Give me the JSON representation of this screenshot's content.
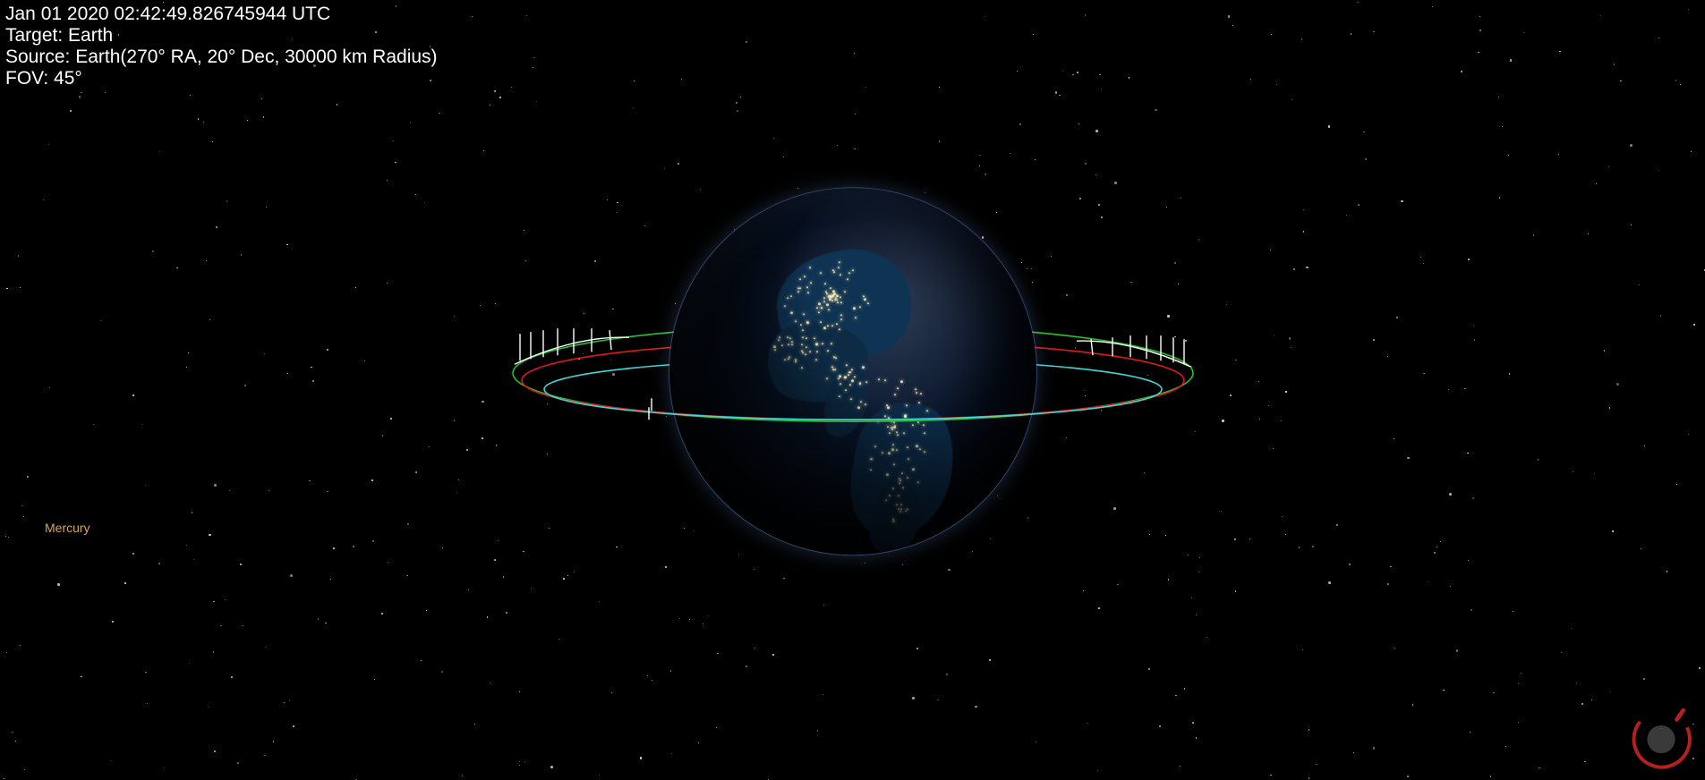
{
  "overlay": {
    "timestamp": "Jan 01 2020 02:42:49.826745944 UTC",
    "target_line": "Target: Earth",
    "source_line": "Source: Earth(270° RA, 20° Dec, 30000 km Radius)",
    "fov_line": "FOV: 45°"
  },
  "labels": {
    "mercury": "Mercury"
  },
  "orbits": {
    "rings": [
      {
        "name": "orbit-green",
        "color": "#27c22f"
      },
      {
        "name": "orbit-red",
        "color": "#e11919"
      },
      {
        "name": "orbit-cyan",
        "color": "#3fd8d8"
      }
    ],
    "bounds_marker_color": "#ffffff"
  },
  "colors": {
    "label_planet": "#d8a55a",
    "text": "#ffffff",
    "logo_orbit": "#b6201f",
    "logo_body": "#3a3a3a"
  }
}
